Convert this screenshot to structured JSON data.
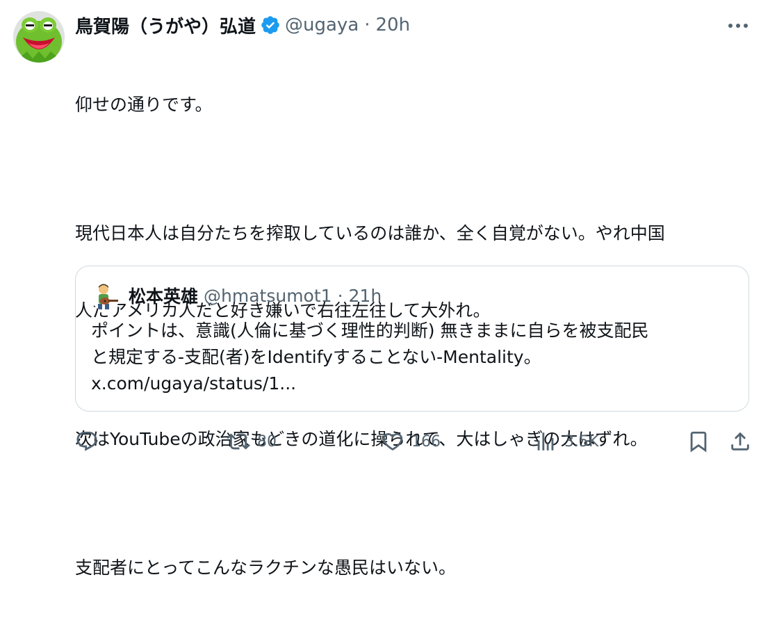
{
  "tweet": {
    "display_name": "鳥賀陽（うがや）弘道",
    "handle": "@ugaya",
    "separator": "·",
    "time": "20h",
    "avatar_icon": "kermit-frog-avatar-icon",
    "verified_icon": "verified-badge-icon",
    "more_icon": "more-dots-icon",
    "paragraphs": [
      "仰せの通りです。",
      "",
      "現代日本人は自分たちを搾取しているのは誰か、全く自覚がない。やれ中国",
      "人だアメリカ人だと好き嫌いで右往左往して大外れ。",
      "",
      "次はYouTubeの政治家もどきの道化に操られて、大はしゃぎの大はずれ。",
      "",
      "支配者にとってこんなラクチンな愚民はいない。"
    ]
  },
  "quote": {
    "display_name": "松本英雄",
    "handle": "@hmatsumot1",
    "separator": "·",
    "time": "21h",
    "avatar_icon": "guitar-player-avatar-icon",
    "lines": [
      "ポイントは、意識(人倫に基づく理性的判断) 無きままに自らを被支配民",
      "と規定する-支配(者)をIdentifyすることない-Mentality。",
      "x.com/ugaya/status/1..."
    ]
  },
  "actions": {
    "reply": {
      "icon": "reply-icon",
      "count": ""
    },
    "retweet": {
      "icon": "retweet-icon",
      "count": "80"
    },
    "like": {
      "icon": "heart-icon",
      "count": "166"
    },
    "views": {
      "icon": "views-chart-icon",
      "count": "3.5K"
    },
    "bookmark": {
      "icon": "bookmark-icon"
    },
    "share": {
      "icon": "share-icon"
    }
  },
  "colors": {
    "text_primary": "#0f1419",
    "text_secondary": "#536471",
    "verified_blue": "#1d9bf0",
    "border": "#cfd9de"
  }
}
